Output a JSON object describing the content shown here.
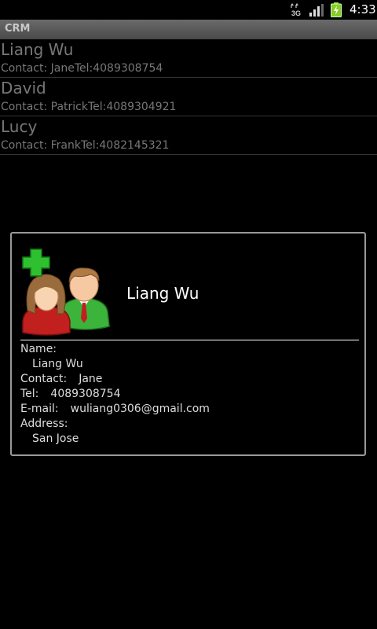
{
  "status_bar": {
    "network_label": "3G",
    "time": "4:33"
  },
  "app": {
    "title": "CRM"
  },
  "customers": [
    {
      "name": "Liang Wu",
      "subtitle": "Contact: JaneTel:4089308754"
    },
    {
      "name": "David",
      "subtitle": "Contact: PatrickTel:4089304921"
    },
    {
      "name": "Lucy",
      "subtitle": "Contact: FrankTel:4082145321"
    }
  ],
  "detail_dialog": {
    "title": "Liang Wu",
    "avatar_icon": "add-contacts-icon",
    "fields": {
      "name_label": "Name:",
      "name_value": "Liang Wu",
      "contact_label": "Contact:",
      "contact_value": "Jane",
      "tel_label": "Tel:",
      "tel_value": "4089308754",
      "email_label": "E-mail:",
      "email_value": "wuliang0306@gmail.com",
      "address_label": "Address:",
      "address_value": "San Jose"
    }
  }
}
